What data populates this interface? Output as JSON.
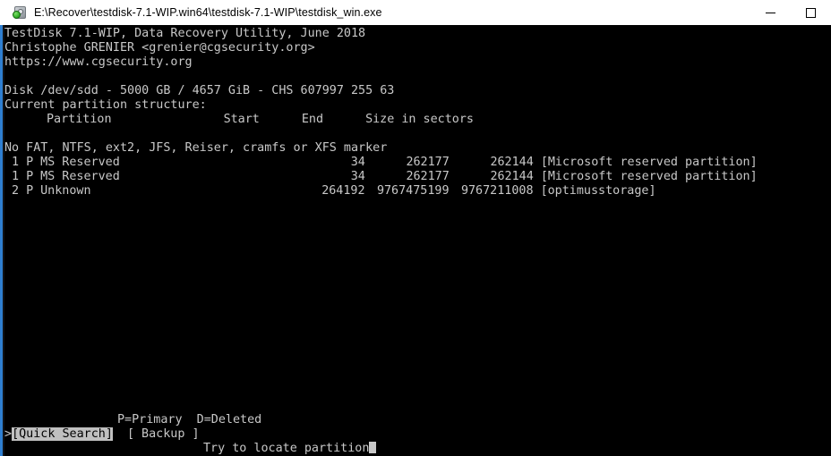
{
  "titlebar": {
    "path": "E:\\Recover\\testdisk-7.1-WIP.win64\\testdisk-7.1-WIP\\testdisk_win.exe",
    "icon": "disk-drive-icon",
    "minimize_label": "—",
    "maximize_label": "□"
  },
  "console": {
    "header": {
      "line1": "TestDisk 7.1-WIP, Data Recovery Utility, June 2018",
      "line2": "Christophe GRENIER <grenier@cgsecurity.org>",
      "line3": "https://www.cgsecurity.org"
    },
    "disk_line": "Disk /dev/sdd - 5000 GB / 4657 GiB - CHS 607997 255 63",
    "structure_label": "Current partition structure:",
    "columns": {
      "partition": "Partition",
      "start": "Start",
      "end": "End",
      "size": "Size in sectors"
    },
    "marker_line": "No FAT, NTFS, ext2, JFS, Reiser, cramfs or XFS marker",
    "partitions": [
      {
        "index": "1",
        "type": "P",
        "name": "MS Reserved",
        "start": "34",
        "end": "262177",
        "size": "262144",
        "label": "[Microsoft reserved partition]"
      },
      {
        "index": "1",
        "type": "P",
        "name": "MS Reserved",
        "start": "34",
        "end": "262177",
        "size": "262144",
        "label": "[Microsoft reserved partition]"
      },
      {
        "index": "2",
        "type": "P",
        "name": "Unknown",
        "start": "264192",
        "end": "9767475199",
        "size": "9767211008",
        "label": "[optimusstorage]"
      }
    ],
    "legend": "P=Primary  D=Deleted",
    "menu": {
      "selector": ">",
      "quick_search": "[Quick Search]",
      "backup": "[ Backup ]"
    },
    "hint": "Try to locate partition",
    "colors": {
      "background": "#000000",
      "foreground": "#c8c8c8",
      "highlight_bg": "#c0c0c0",
      "highlight_fg": "#000000",
      "window_border": "#2f7fd1"
    }
  }
}
